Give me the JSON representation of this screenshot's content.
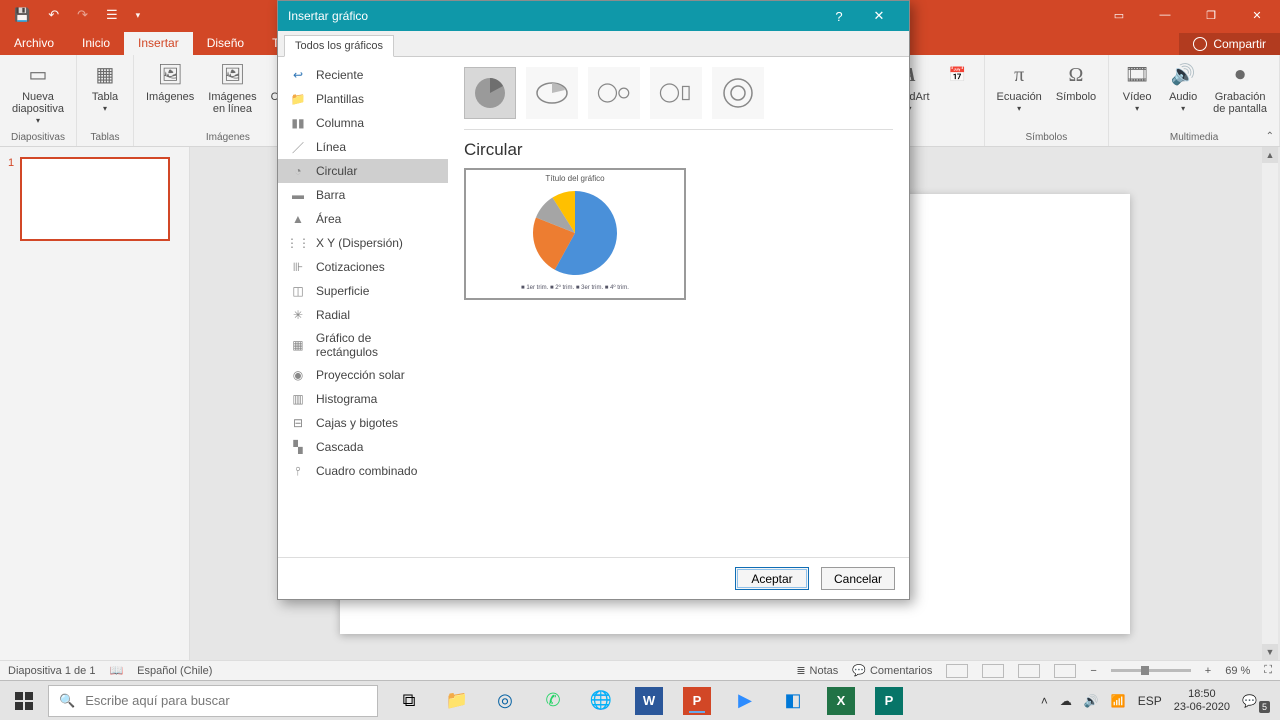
{
  "titlebar": {
    "qat": [
      "save-icon",
      "undo-icon",
      "redo-icon",
      "touch-icon",
      "customize-icon"
    ]
  },
  "menus": {
    "tabs": [
      "Archivo",
      "Inicio",
      "Insertar",
      "Diseño",
      "Transiciones"
    ],
    "active_index": 2,
    "share": "Compartir"
  },
  "ribbon": {
    "groups": [
      {
        "label": "Diapositivas",
        "buttons": [
          {
            "label": "Nueva\ndiapositiva",
            "dropdown": true
          }
        ]
      },
      {
        "label": "Tablas",
        "buttons": [
          {
            "label": "Tabla",
            "dropdown": true
          }
        ]
      },
      {
        "label": "Imágenes",
        "buttons": [
          {
            "label": "Imágenes"
          },
          {
            "label": "Imágenes\nen línea"
          },
          {
            "label": "Captura",
            "dropdown": true
          }
        ]
      }
    ],
    "right_groups": [
      {
        "label": "",
        "buttons": [
          {
            "label": "WordArt",
            "dropdown": true
          }
        ]
      },
      {
        "label": "Símbolos",
        "buttons": [
          {
            "label": "Ecuación",
            "dropdown": true
          },
          {
            "label": "Símbolo"
          }
        ]
      },
      {
        "label": "Multimedia",
        "buttons": [
          {
            "label": "Vídeo",
            "dropdown": true
          },
          {
            "label": "Audio",
            "dropdown": true
          },
          {
            "label": "Grabación\nde pantalla"
          }
        ]
      }
    ]
  },
  "thumbs": {
    "slide_number": "1"
  },
  "status": {
    "slide": "Diapositiva 1 de 1",
    "lang": "Español (Chile)",
    "notes": "Notas",
    "comments": "Comentarios",
    "zoom": "69 %"
  },
  "taskbar": {
    "search_placeholder": "Escribe aquí para buscar",
    "ime": "ESP",
    "time": "18:50",
    "date": "23-06-2020",
    "notif": "5"
  },
  "dialog": {
    "title": "Insertar gráfico",
    "tab": "Todos los gráficos",
    "categories": [
      "Reciente",
      "Plantillas",
      "Columna",
      "Línea",
      "Circular",
      "Barra",
      "Área",
      "X Y (Dispersión)",
      "Cotizaciones",
      "Superficie",
      "Radial",
      "Gráfico de rectángulos",
      "Proyección solar",
      "Histograma",
      "Cajas y bigotes",
      "Cascada",
      "Cuadro combinado"
    ],
    "selected_index": 4,
    "heading": "Circular",
    "preview_title": "Título del gráfico",
    "preview_legend": "■ 1er trim.   ■ 2º trim.   ■ 3er trim.   ■ 4º trim.",
    "accept": "Aceptar",
    "cancel": "Cancelar"
  },
  "chart_data": {
    "type": "pie",
    "title": "Título del gráfico",
    "categories": [
      "1er trim.",
      "2º trim.",
      "3er trim.",
      "4º trim."
    ],
    "values": [
      58,
      23,
      10,
      9
    ],
    "colors": [
      "#4a90d9",
      "#ed7d31",
      "#a5a5a5",
      "#ffc000"
    ]
  }
}
